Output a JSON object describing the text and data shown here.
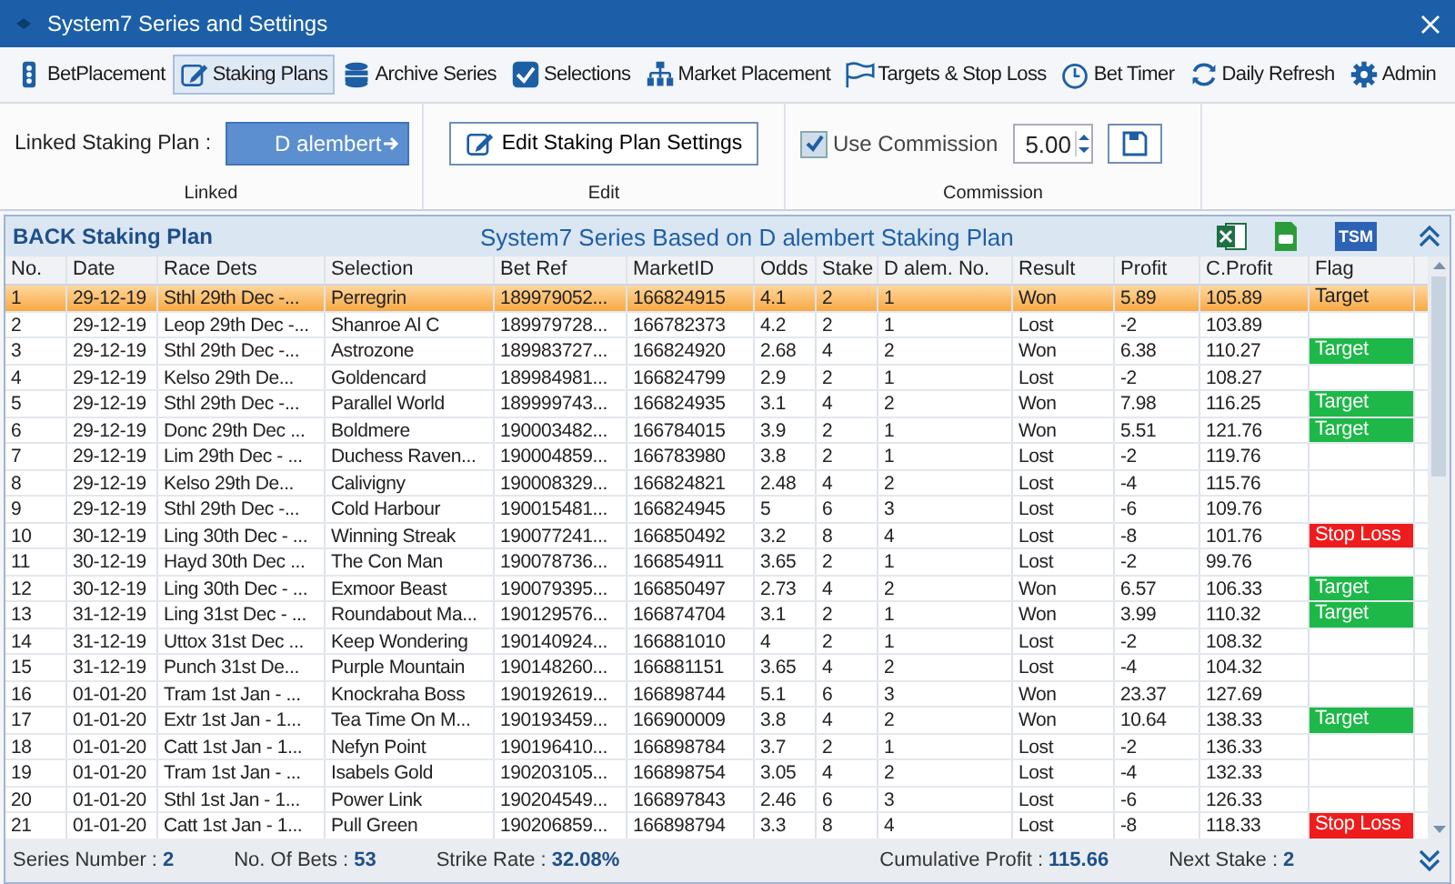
{
  "window": {
    "title": "System7 Series and Settings"
  },
  "tabs": [
    {
      "label": "BetPlacement",
      "selected": false
    },
    {
      "label": "Staking Plans",
      "selected": true
    },
    {
      "label": "Archive Series",
      "selected": false
    },
    {
      "label": "Selections",
      "selected": false
    },
    {
      "label": "Market Placement",
      "selected": false
    },
    {
      "label": "Targets & Stop Loss",
      "selected": false
    },
    {
      "label": "Bet Timer",
      "selected": false
    },
    {
      "label": "Daily Refresh",
      "selected": false
    },
    {
      "label": "Admin",
      "selected": false
    }
  ],
  "ribbon": {
    "linked": {
      "label": "Linked Staking Plan :",
      "value": "D alembert",
      "group": "Linked"
    },
    "edit": {
      "button": "Edit Staking Plan Settings",
      "group": "Edit"
    },
    "commission": {
      "label": "Use Commission",
      "checked": true,
      "value": "5.00",
      "group": "Commission"
    }
  },
  "panel": {
    "title": "BACK Staking Plan",
    "subtitle": "System7 Series Based on D alembert Staking Plan",
    "export_badge": "TSM"
  },
  "table": {
    "columns": [
      "No.",
      "Date",
      "Race Dets",
      "Selection",
      "Bet Ref",
      "MarketID",
      "Odds",
      "Stake",
      "D alem. No.",
      "Result",
      "Profit",
      "C.Profit",
      "Flag"
    ],
    "rows": [
      {
        "cells": [
          "1",
          "29-12-19",
          "Sthl  29th Dec -...",
          "Perregrin",
          "189979052...",
          "166824915",
          "4.1",
          "2",
          "1",
          "Won",
          "5.89",
          "105.89",
          "Target"
        ],
        "kind": "plain",
        "selected": true
      },
      {
        "cells": [
          "2",
          "29-12-19",
          "Leop 29th Dec -...",
          "Shanroe Al C",
          "189979728...",
          "166782373",
          "4.2",
          "2",
          "1",
          "Lost",
          "-2",
          "103.89",
          ""
        ],
        "kind": "none",
        "selected": false
      },
      {
        "cells": [
          "3",
          "29-12-19",
          "Sthl  29th Dec -...",
          "Astrozone",
          "189983727...",
          "166824920",
          "2.68",
          "4",
          "2",
          "Won",
          "6.38",
          "110.27",
          "Target"
        ],
        "kind": "target",
        "selected": false
      },
      {
        "cells": [
          "4",
          "29-12-19",
          "Kelso  29th De...",
          "Goldencard",
          "189984981...",
          "166824799",
          "2.9",
          "2",
          "1",
          "Lost",
          "-2",
          "108.27",
          ""
        ],
        "kind": "none",
        "selected": false
      },
      {
        "cells": [
          "5",
          "29-12-19",
          "Sthl  29th Dec -...",
          "Parallel World",
          "189999743...",
          "166824935",
          "3.1",
          "4",
          "2",
          "Won",
          "7.98",
          "116.25",
          "Target"
        ],
        "kind": "target",
        "selected": false
      },
      {
        "cells": [
          "6",
          "29-12-19",
          "Donc 29th Dec ...",
          "Boldmere",
          "190003482...",
          "166784015",
          "3.9",
          "2",
          "1",
          "Won",
          "5.51",
          "121.76",
          "Target"
        ],
        "kind": "target",
        "selected": false
      },
      {
        "cells": [
          "7",
          "29-12-19",
          "Lim 29th Dec - ...",
          "Duchess Raven...",
          "190004859...",
          "166783980",
          "3.8",
          "2",
          "1",
          "Lost",
          "-2",
          "119.76",
          ""
        ],
        "kind": "none",
        "selected": false
      },
      {
        "cells": [
          "8",
          "29-12-19",
          "Kelso  29th De...",
          "Calivigny",
          "190008329...",
          "166824821",
          "2.48",
          "4",
          "2",
          "Lost",
          "-4",
          "115.76",
          ""
        ],
        "kind": "none",
        "selected": false
      },
      {
        "cells": [
          "9",
          "29-12-19",
          "Sthl  29th Dec -...",
          "Cold Harbour",
          "190015481...",
          "166824945",
          "5",
          "6",
          "3",
          "Lost",
          "-6",
          "109.76",
          ""
        ],
        "kind": "none",
        "selected": false
      },
      {
        "cells": [
          "10",
          "30-12-19",
          "Ling 30th Dec - ...",
          "Winning Streak",
          "190077241...",
          "166850492",
          "3.2",
          "8",
          "4",
          "Lost",
          "-8",
          "101.76",
          "Stop Loss"
        ],
        "kind": "stop_loss",
        "selected": false
      },
      {
        "cells": [
          "11",
          "30-12-19",
          "Hayd 30th Dec ...",
          "The Con Man",
          "190078736...",
          "166854911",
          "3.65",
          "2",
          "1",
          "Lost",
          "-2",
          "99.76",
          ""
        ],
        "kind": "none",
        "selected": false
      },
      {
        "cells": [
          "12",
          "30-12-19",
          "Ling 30th Dec - ...",
          "Exmoor Beast",
          "190079395...",
          "166850497",
          "2.73",
          "4",
          "2",
          "Won",
          "6.57",
          "106.33",
          "Target"
        ],
        "kind": "target",
        "selected": false
      },
      {
        "cells": [
          "13",
          "31-12-19",
          "Ling 31st Dec - ...",
          "Roundabout Ma...",
          "190129576...",
          "166874704",
          "3.1",
          "2",
          "1",
          "Won",
          "3.99",
          "110.32",
          "Target"
        ],
        "kind": "target",
        "selected": false
      },
      {
        "cells": [
          "14",
          "31-12-19",
          "Uttox 31st Dec ...",
          "Keep Wondering",
          "190140924...",
          "166881010",
          "4",
          "2",
          "1",
          "Lost",
          "-2",
          "108.32",
          ""
        ],
        "kind": "none",
        "selected": false
      },
      {
        "cells": [
          "15",
          "31-12-19",
          "Punch 31st De...",
          "Purple Mountain",
          "190148260...",
          "166881151",
          "3.65",
          "4",
          "2",
          "Lost",
          "-4",
          "104.32",
          ""
        ],
        "kind": "none",
        "selected": false
      },
      {
        "cells": [
          "16",
          "01-01-20",
          "Tram 1st Jan - ...",
          "Knockraha Boss",
          "190192619...",
          "166898744",
          "5.1",
          "6",
          "3",
          "Won",
          "23.37",
          "127.69",
          ""
        ],
        "kind": "none",
        "selected": false
      },
      {
        "cells": [
          "17",
          "01-01-20",
          "Extr 1st Jan - 1...",
          "Tea Time On M...",
          "190193459...",
          "166900009",
          "3.8",
          "4",
          "2",
          "Won",
          "10.64",
          "138.33",
          "Target"
        ],
        "kind": "target",
        "selected": false
      },
      {
        "cells": [
          "18",
          "01-01-20",
          "Catt 1st Jan - 1...",
          "Nefyn Point",
          "190196410...",
          "166898784",
          "3.7",
          "2",
          "1",
          "Lost",
          "-2",
          "136.33",
          ""
        ],
        "kind": "none",
        "selected": false
      },
      {
        "cells": [
          "19",
          "01-01-20",
          "Tram 1st Jan - ...",
          "Isabels Gold",
          "190203105...",
          "166898754",
          "3.05",
          "4",
          "2",
          "Lost",
          "-4",
          "132.33",
          ""
        ],
        "kind": "none",
        "selected": false
      },
      {
        "cells": [
          "20",
          "01-01-20",
          "Sthl 1st Jan - 1...",
          "Power Link",
          "190204549...",
          "166897843",
          "2.46",
          "6",
          "3",
          "Lost",
          "-6",
          "126.33",
          ""
        ],
        "kind": "none",
        "selected": false
      },
      {
        "cells": [
          "21",
          "01-01-20",
          "Catt 1st Jan - 1...",
          "Pull Green",
          "190206859...",
          "166898794",
          "3.3",
          "8",
          "4",
          "Lost",
          "-8",
          "118.33",
          "Stop Loss"
        ],
        "kind": "stop_loss",
        "selected": false
      }
    ]
  },
  "status_bar": [
    {
      "label": "Series Number :",
      "value": "2"
    },
    {
      "label": "No. Of Bets :",
      "value": "53"
    },
    {
      "label": "Strike Rate :",
      "value": "32.08%"
    },
    {
      "label": "Cumulative Profit :",
      "value": "115.66"
    },
    {
      "label": "Next Stake :",
      "value": "2"
    }
  ]
}
